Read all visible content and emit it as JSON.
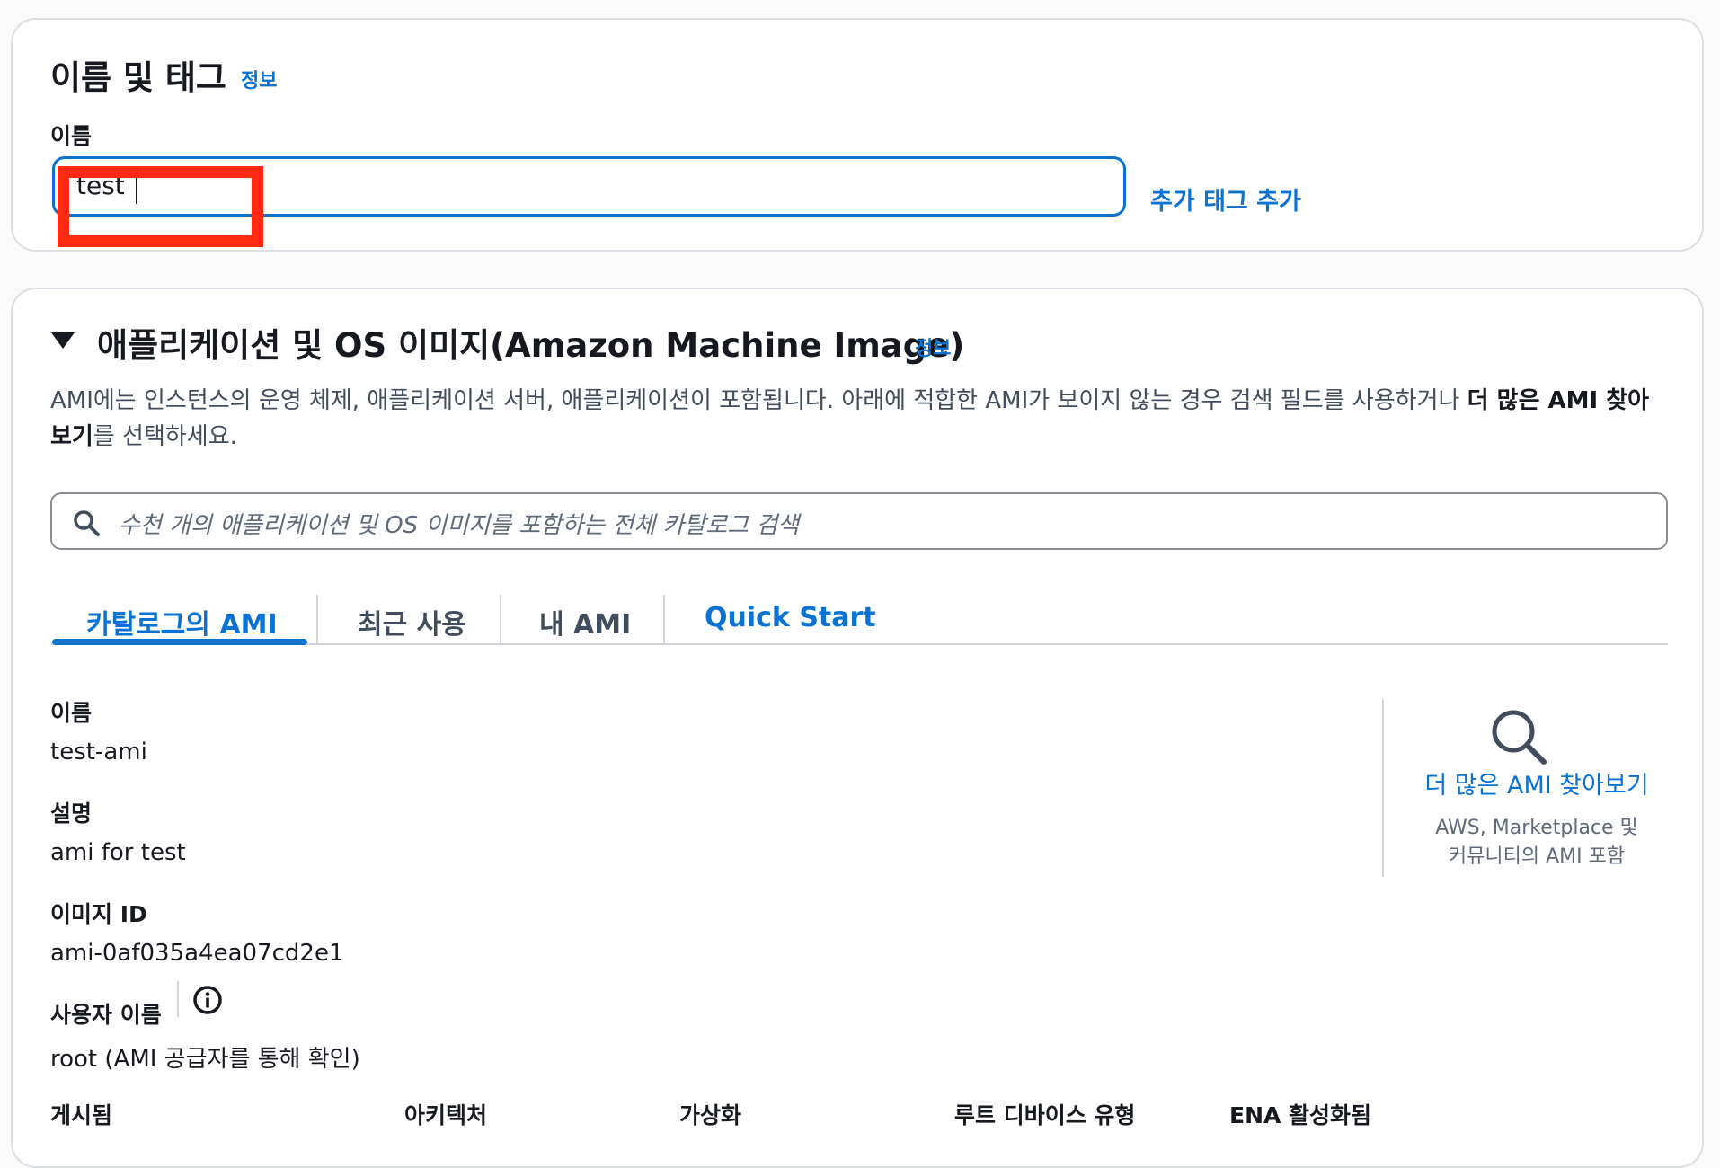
{
  "name_section": {
    "title": "이름 및 태그",
    "info": "정보",
    "name_label": "이름",
    "name_value": "test",
    "add_tag_label": "추가 태그 추가"
  },
  "ami_section": {
    "title": "애플리케이션 및 OS 이미지(Amazon Machine Image)",
    "info": "정보",
    "description_part1": "AMI에는 인스턴스의 운영 체제, 애플리케이션 서버, 애플리케이션이 포함됩니다. 아래에 적합한 AMI가 보이지 않는 경우 검색 필드를 사용하거나 ",
    "description_bold": "더 많은 AMI 찾아보기",
    "description_part2": "를 선택하세요.",
    "search_placeholder": "수천 개의 애플리케이션 및 OS 이미지를 포함하는 전체 카탈로그 검색",
    "tabs": [
      "카탈로그의 AMI",
      "최근 사용",
      "내 AMI",
      "Quick Start"
    ],
    "details": {
      "name_label": "이름",
      "name_value": "test-ami",
      "description_label": "설명",
      "description_value": "ami for test",
      "image_id_label": "이미지 ID",
      "image_id_value": "ami-0af035a4ea07cd2e1",
      "username_label": "사용자 이름",
      "username_value": "root (AMI 공급자를 통해 확인)"
    },
    "columns": [
      "게시됨",
      "아키텍처",
      "가상화",
      "루트 디바이스 유형",
      "ENA 활성화됨"
    ],
    "browse_more": {
      "link": "더 많은 AMI 찾아보기",
      "sub_line1": "AWS, Marketplace 및",
      "sub_line2": "커뮤니티의 AMI 포함"
    }
  },
  "colors": {
    "link": "#0972d3",
    "highlight": "#ff2a12"
  },
  "icons": [
    "search-icon",
    "magnifier-icon",
    "info-icon",
    "caret-down-icon"
  ]
}
